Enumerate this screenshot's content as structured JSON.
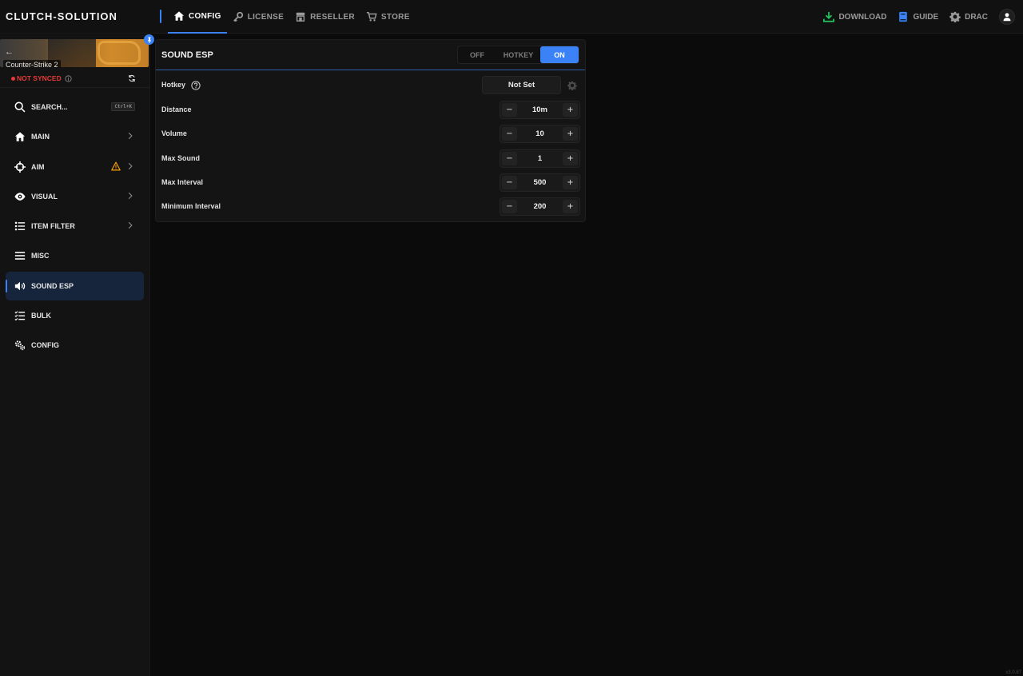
{
  "brand": "CLUTCH-SOLUTION",
  "nav": {
    "items": [
      {
        "label": "CONFIG",
        "icon": "home-icon",
        "active": true
      },
      {
        "label": "LICENSE",
        "icon": "key-icon",
        "active": false
      },
      {
        "label": "RESELLER",
        "icon": "store-icon",
        "active": false
      },
      {
        "label": "STORE",
        "icon": "cart-icon",
        "active": false
      }
    ]
  },
  "tools": {
    "download": "DOWNLOAD",
    "guide": "GUIDE",
    "user": "DRAC"
  },
  "sidebar": {
    "game": "Counter-Strike 2",
    "sync_status": "NOT SYNCED",
    "search_label": "SEARCH...",
    "search_shortcut": "Ctrl+K",
    "items": [
      {
        "label": "MAIN",
        "icon": "home-icon"
      },
      {
        "label": "AIM",
        "icon": "crosshair-icon"
      },
      {
        "label": "VISUAL",
        "icon": "eye-icon"
      },
      {
        "label": "ITEM FILTER",
        "icon": "list-icon"
      },
      {
        "label": "MISC",
        "icon": "menu-icon"
      },
      {
        "label": "SOUND ESP",
        "icon": "speaker-icon"
      },
      {
        "label": "BULK",
        "icon": "checklist-icon"
      },
      {
        "label": "CONFIG",
        "icon": "gears-icon"
      }
    ]
  },
  "panel": {
    "title": "SOUND ESP",
    "mode": {
      "off": "OFF",
      "hotkey": "HOTKEY",
      "on": "ON",
      "selected": "ON"
    },
    "hotkey": {
      "label": "Hotkey",
      "value": "Not Set"
    },
    "settings": [
      {
        "label": "Distance",
        "value": "10m"
      },
      {
        "label": "Volume",
        "value": "10"
      },
      {
        "label": "Max Sound",
        "value": "1"
      },
      {
        "label": "Max Interval",
        "value": "500"
      },
      {
        "label": "Minimum Interval",
        "value": "200"
      }
    ]
  },
  "stepper": {
    "minus": "−",
    "plus": "+"
  },
  "version": "v3.0.87",
  "colors": {
    "accent": "#3b82f6",
    "danger": "#e53935",
    "warning": "#f59e0b",
    "download": "#22c55e"
  }
}
